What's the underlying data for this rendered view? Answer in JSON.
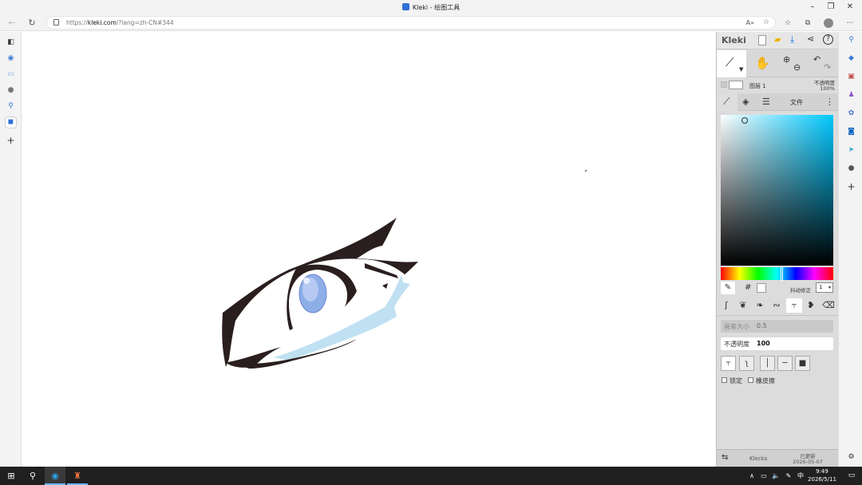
{
  "browser": {
    "tab_title": "Kleki - 绘图工具",
    "url": "https://kleki.com/?lang=zh-CN#344",
    "url_host": "kleki.com",
    "url_prefix": "https://",
    "url_suffix": "/?lang=zh-CN#344"
  },
  "kleki": {
    "logo": "Kleki",
    "layer": {
      "name": "图层 1",
      "opacity_label": "不透明度",
      "opacity_value": "100%"
    },
    "tabs": {
      "file": "文件"
    },
    "color": {
      "hex_symbol": "#",
      "stabilizer_label": "抖动修正",
      "stabilizer_value": "1",
      "hue_color": "#00c8ff",
      "primary": "#ffffff"
    },
    "brush": {
      "size_label": "画笔大小",
      "size_value": "0.5",
      "size_fraction": 0.01,
      "opacity_label": "不透明度",
      "opacity_value": "100",
      "opacity_fraction": 1.0,
      "lock_label": "锁定",
      "eraser_label": "橡皮擦"
    },
    "footer": {
      "klecks": "Klecks",
      "updated_label": "已更新",
      "updated_date": "2026-05-07"
    }
  },
  "taskbar": {
    "ime": "中",
    "time": "9:49",
    "date": "2026/5/11"
  }
}
